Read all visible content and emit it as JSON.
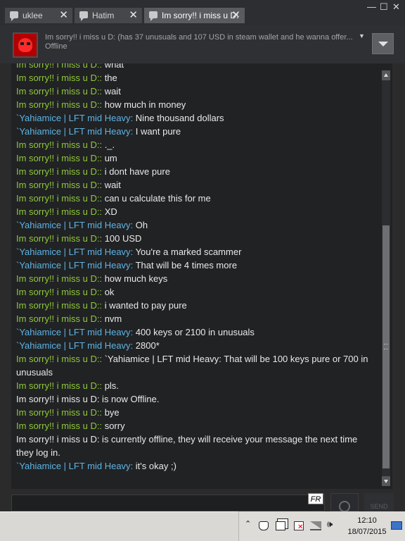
{
  "tabs": [
    {
      "label": "uklee",
      "active": false
    },
    {
      "label": "Hatim",
      "active": false
    },
    {
      "label": "Im sorry!! i miss u D:",
      "active": true
    }
  ],
  "window_controls": {
    "minimize": "—",
    "maximize": "☐",
    "close": "✕"
  },
  "header": {
    "name_line": "Im sorry!! i miss u D: (has 37 unusuals and 107 USD in steam wallet and he wanna offer...",
    "status": "Offline",
    "caret": "▼"
  },
  "colors": {
    "friend_green": "#8fc93a",
    "user_blue": "#5eb4e4",
    "message_text": "#e9e9e9",
    "log_bg": "#212224"
  },
  "messages": [
    {
      "sender": "Im sorry!! i miss u D:",
      "sep": ": ",
      "text": "what"
    },
    {
      "sender": "Im sorry!! i miss u D:",
      "sep": ": ",
      "text": "the"
    },
    {
      "sender": "Im sorry!! i miss u D:",
      "sep": ": ",
      "text": "wait"
    },
    {
      "sender": "Im sorry!! i miss u D:",
      "sep": ": ",
      "text": "how much in money"
    },
    {
      "sender": "`Yahiamice | LFT mid Heavy",
      "sep": ": ",
      "text": "Nine thousand dollars"
    },
    {
      "sender": "`Yahiamice | LFT mid Heavy",
      "sep": ": ",
      "text": "I want pure"
    },
    {
      "sender": "Im sorry!! i miss u D:",
      "sep": ": ",
      "text": "._."
    },
    {
      "sender": "Im sorry!! i miss u D:",
      "sep": ": ",
      "text": "um"
    },
    {
      "sender": "Im sorry!! i miss u D:",
      "sep": ": ",
      "text": "i dont have pure"
    },
    {
      "sender": "Im sorry!! i miss u D:",
      "sep": ": ",
      "text": "wait"
    },
    {
      "sender": "Im sorry!! i miss u D:",
      "sep": ": ",
      "text": "can u calculate this for me"
    },
    {
      "sender": "Im sorry!! i miss u D:",
      "sep": ": ",
      "text": "XD"
    },
    {
      "sender": "`Yahiamice | LFT mid Heavy",
      "sep": ": ",
      "text": "Oh"
    },
    {
      "sender": "Im sorry!! i miss u D:",
      "sep": ": ",
      "text": "100 USD"
    },
    {
      "sender": "`Yahiamice | LFT mid Heavy",
      "sep": ": ",
      "text": "You're a marked scammer"
    },
    {
      "sender": "`Yahiamice | LFT mid Heavy",
      "sep": ": ",
      "text": "That will be 4 times more"
    },
    {
      "sender": "Im sorry!! i miss u D:",
      "sep": ": ",
      "text": "how much keys"
    },
    {
      "sender": "Im sorry!! i miss u D:",
      "sep": ": ",
      "text": "ok"
    },
    {
      "sender": "Im sorry!! i miss u D:",
      "sep": ": ",
      "text": "i wanted to pay pure"
    },
    {
      "sender": "Im sorry!! i miss u D:",
      "sep": ": ",
      "text": "nvm"
    },
    {
      "sender": "`Yahiamice | LFT mid Heavy",
      "sep": ": ",
      "text": "400 keys or 2100 in unusuals"
    },
    {
      "sender": "`Yahiamice | LFT mid Heavy",
      "sep": ": ",
      "text": "2800*"
    },
    {
      "sender": "Im sorry!! i miss u D:",
      "sep": ": ",
      "text": "`Yahiamice | LFT mid Heavy: That will be 100 keys pure or 700 in unusuals"
    },
    {
      "sender": "Im sorry!! i miss u D:",
      "sep": ": ",
      "text": "pls."
    },
    {
      "sender": "",
      "sep": "",
      "text": "Im sorry!! i miss u D: is now Offline."
    },
    {
      "sender": "Im sorry!! i miss u D:",
      "sep": ": ",
      "text": "bye"
    },
    {
      "sender": "Im sorry!! i miss u D:",
      "sep": ": ",
      "text": "sorry"
    },
    {
      "sender": "",
      "sep": "",
      "text": "Im sorry!! i miss u D: is currently offline, they will receive your message the next time they log in."
    },
    {
      "sender": "`Yahiamice | LFT mid Heavy",
      "sep": ": ",
      "text": "it's okay ;)"
    }
  ],
  "input": {
    "lang_badge": "FR",
    "send_label": "SEND"
  },
  "taskbar": {
    "time": "12:10",
    "date": "18/07/2015",
    "tray_expand": "⌃",
    "volume_glyph": "🕪"
  },
  "icons": {
    "tab": "chat-bubble-icon",
    "tray": [
      "show-hidden-icons-icon",
      "touch-hand-icon",
      "documents-icon",
      "action-center-flag-icon",
      "network-signal-icon",
      "volume-icon"
    ]
  }
}
